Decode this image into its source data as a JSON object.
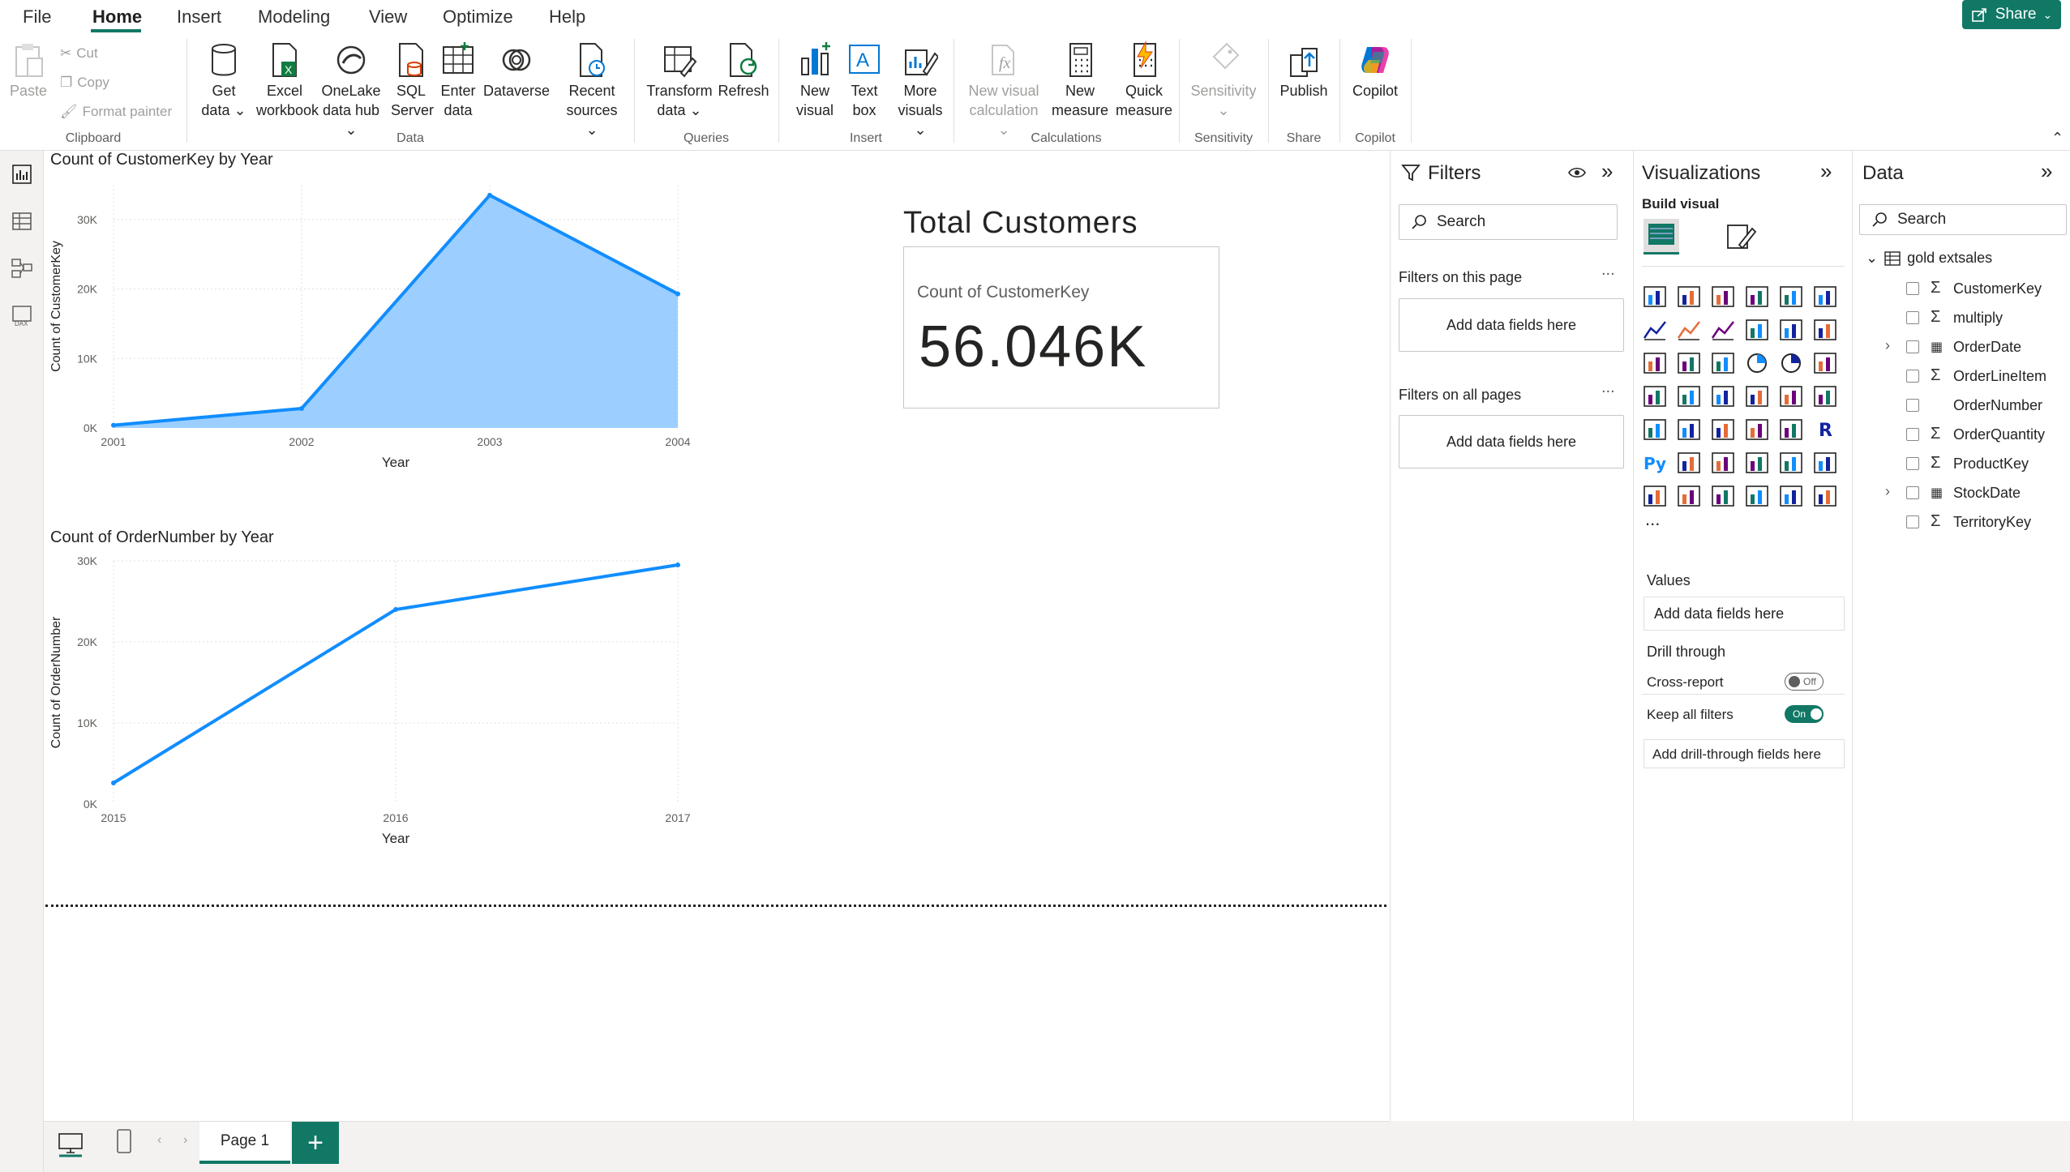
{
  "menu": {
    "items": [
      "File",
      "Home",
      "Insert",
      "Modeling",
      "View",
      "Optimize",
      "Help"
    ],
    "active": "Home"
  },
  "share": {
    "label": "Share"
  },
  "ribbon": {
    "clipboard": {
      "label": "Clipboard",
      "paste": "Paste",
      "cut": "Cut",
      "copy": "Copy",
      "format_painter": "Format painter"
    },
    "data": {
      "label": "Data",
      "get_data_1": "Get",
      "get_data_2": "data",
      "excel_1": "Excel",
      "excel_2": "workbook",
      "onelake_1": "OneLake",
      "onelake_2": "data hub",
      "sql_1": "SQL",
      "sql_2": "Server",
      "enter_1": "Enter",
      "enter_2": "data",
      "dataverse": "Dataverse",
      "recent_1": "Recent",
      "recent_2": "sources"
    },
    "queries": {
      "label": "Queries",
      "transform_1": "Transform",
      "transform_2": "data",
      "refresh": "Refresh"
    },
    "insert": {
      "label": "Insert",
      "new_visual_1": "New",
      "new_visual_2": "visual",
      "text_box_1": "Text",
      "text_box_2": "box",
      "more_visuals_1": "More",
      "more_visuals_2": "visuals"
    },
    "calculations": {
      "label": "Calculations",
      "new_calc_1": "New visual",
      "new_calc_2": "calculation",
      "new_measure_1": "New",
      "new_measure_2": "measure",
      "quick_measure_1": "Quick",
      "quick_measure_2": "measure"
    },
    "sensitivity": {
      "label": "Sensitivity",
      "button": "Sensitivity"
    },
    "share": {
      "label": "Share",
      "publish": "Publish"
    },
    "copilot": {
      "label": "Copilot",
      "button": "Copilot"
    }
  },
  "canvas": {
    "card": {
      "title": "Total Customers",
      "label": "Count of CustomerKey",
      "value": "56.046K"
    }
  },
  "chart_data": [
    {
      "type": "area",
      "title": "Count of CustomerKey by Year",
      "xlabel": "Year",
      "ylabel": "Count of CustomerKey",
      "x": [
        "2001",
        "2002",
        "2003",
        "2004"
      ],
      "values": [
        400,
        2800,
        33500,
        19300
      ],
      "yticks": [
        "0K",
        "10K",
        "20K",
        "30K"
      ],
      "ylim": [
        0,
        35000
      ],
      "grid": true,
      "color": "#118DFF"
    },
    {
      "type": "line",
      "title": "Count of OrderNumber by Year",
      "xlabel": "Year",
      "ylabel": "Count of OrderNumber",
      "x": [
        "2015",
        "2016",
        "2017"
      ],
      "values": [
        2600,
        24000,
        29500
      ],
      "yticks": [
        "0K",
        "10K",
        "20K",
        "30K"
      ],
      "ylim": [
        0,
        30000
      ],
      "grid": true,
      "color": "#118DFF"
    }
  ],
  "pagebar": {
    "tab": "Page 1",
    "add": "+"
  },
  "filters": {
    "title": "Filters",
    "search_placeholder": "Search",
    "on_page": "Filters on this page",
    "on_all": "Filters on all pages",
    "drop1": "Add data fields here",
    "drop2": "Add data fields here",
    "more": "..."
  },
  "viz": {
    "title": "Visualizations",
    "build": "Build visual",
    "more": "...",
    "values": "Values",
    "values_drop": "Add data fields here",
    "drill": "Drill through",
    "cross": "Cross-report",
    "cross_state": "Off",
    "keep": "Keep all filters",
    "keep_state": "On",
    "drill_drop": "Add drill-through fields here"
  },
  "data": {
    "title": "Data",
    "search_placeholder": "Search",
    "table": "gold extsales",
    "fields": [
      {
        "name": "CustomerKey",
        "sigma": true,
        "expand": false,
        "date": false
      },
      {
        "name": "multiply",
        "sigma": true,
        "expand": false,
        "date": false
      },
      {
        "name": "OrderDate",
        "sigma": false,
        "expand": true,
        "date": true
      },
      {
        "name": "OrderLineItem",
        "sigma": true,
        "expand": false,
        "date": false
      },
      {
        "name": "OrderNumber",
        "sigma": false,
        "expand": false,
        "date": false
      },
      {
        "name": "OrderQuantity",
        "sigma": true,
        "expand": false,
        "date": false
      },
      {
        "name": "ProductKey",
        "sigma": true,
        "expand": false,
        "date": false
      },
      {
        "name": "StockDate",
        "sigma": false,
        "expand": true,
        "date": true
      },
      {
        "name": "TerritoryKey",
        "sigma": true,
        "expand": false,
        "date": false
      }
    ]
  },
  "colors": {
    "accent": "#117865",
    "series": "#118DFF",
    "area": "#9CCFFF"
  }
}
